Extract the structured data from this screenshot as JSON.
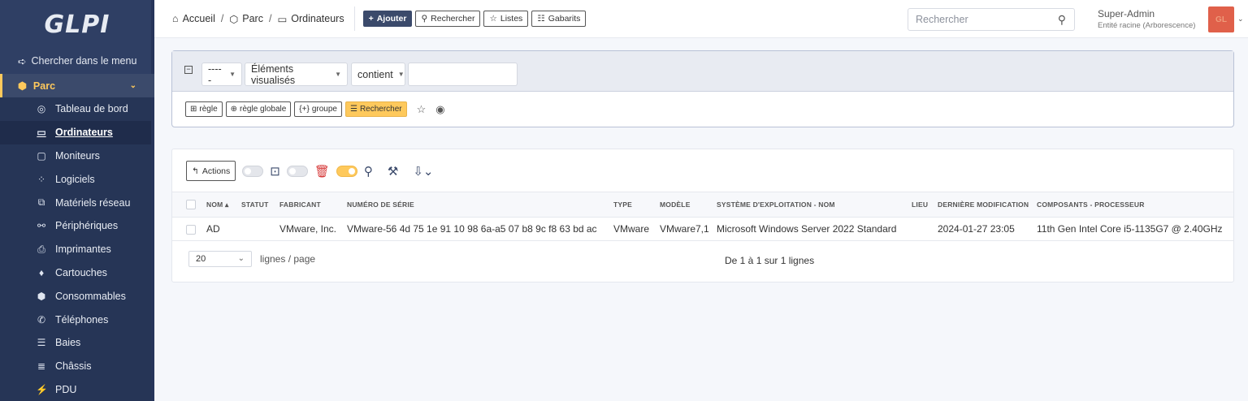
{
  "app": {
    "logo": "GLPI"
  },
  "sidebar": {
    "search_label": "Chercher dans le menu",
    "section": {
      "label": "Parc"
    },
    "items": [
      {
        "label": "Tableau de bord",
        "icon": "dashboard-icon"
      },
      {
        "label": "Ordinateurs",
        "icon": "computer-icon",
        "active": true
      },
      {
        "label": "Moniteurs",
        "icon": "monitor-icon"
      },
      {
        "label": "Logiciels",
        "icon": "software-icon"
      },
      {
        "label": "Matériels réseau",
        "icon": "network-icon"
      },
      {
        "label": "Périphériques",
        "icon": "usb-icon"
      },
      {
        "label": "Imprimantes",
        "icon": "printer-icon"
      },
      {
        "label": "Cartouches",
        "icon": "droplet-icon"
      },
      {
        "label": "Consommables",
        "icon": "package-icon"
      },
      {
        "label": "Téléphones",
        "icon": "phone-icon"
      },
      {
        "label": "Baies",
        "icon": "server-icon"
      },
      {
        "label": "Châssis",
        "icon": "columns-icon"
      },
      {
        "label": "PDU",
        "icon": "plug-icon"
      }
    ]
  },
  "header": {
    "breadcrumbs": [
      "Accueil",
      "Parc",
      "Ordinateurs"
    ],
    "buttons": {
      "add": "Ajouter",
      "search": "Rechercher",
      "lists": "Listes",
      "templates": "Gabarits"
    },
    "search_placeholder": "Rechercher",
    "user_name": "Super-Admin",
    "user_entity": "Entité racine (Arborescence)",
    "avatar_initials": "GL"
  },
  "criteria": {
    "field_select": "-----",
    "view_select": "Éléments visualisés",
    "operator_select": "contient",
    "value": "",
    "buttons": {
      "rule": "règle",
      "global_rule": "règle globale",
      "group": "groupe",
      "search": "Rechercher"
    }
  },
  "results": {
    "actions_label": "Actions",
    "columns": [
      "NOM",
      "STATUT",
      "FABRICANT",
      "NUMÉRO DE SÉRIE",
      "TYPE",
      "MODÈLE",
      "SYSTÈME D'EXPLOITATION - NOM",
      "LIEU",
      "DERNIÈRE MODIFICATION",
      "COMPOSANTS - PROCESSEUR"
    ],
    "rows": [
      {
        "name": "AD",
        "status": "",
        "manufacturer": "VMware, Inc.",
        "serial": "VMware-56 4d 75 1e 91 10 98 6a-a5 07 b8 9c f8 63 bd ac",
        "type": "VMware",
        "model": "VMware7,1",
        "os": "Microsoft Windows Server 2022 Standard",
        "location": "",
        "modified": "2024-01-27 23:05",
        "processor": "11th Gen Intel Core i5-1135G7 @ 2.40GHz"
      }
    ],
    "page_size": "20",
    "page_size_label": "lignes / page",
    "range_text": "De 1 à 1 sur 1 lignes"
  },
  "colors": {
    "sidebar": "#2f3f64",
    "accent": "#fec95c",
    "primary": "#3b4a6b",
    "danger": "#d63939"
  }
}
